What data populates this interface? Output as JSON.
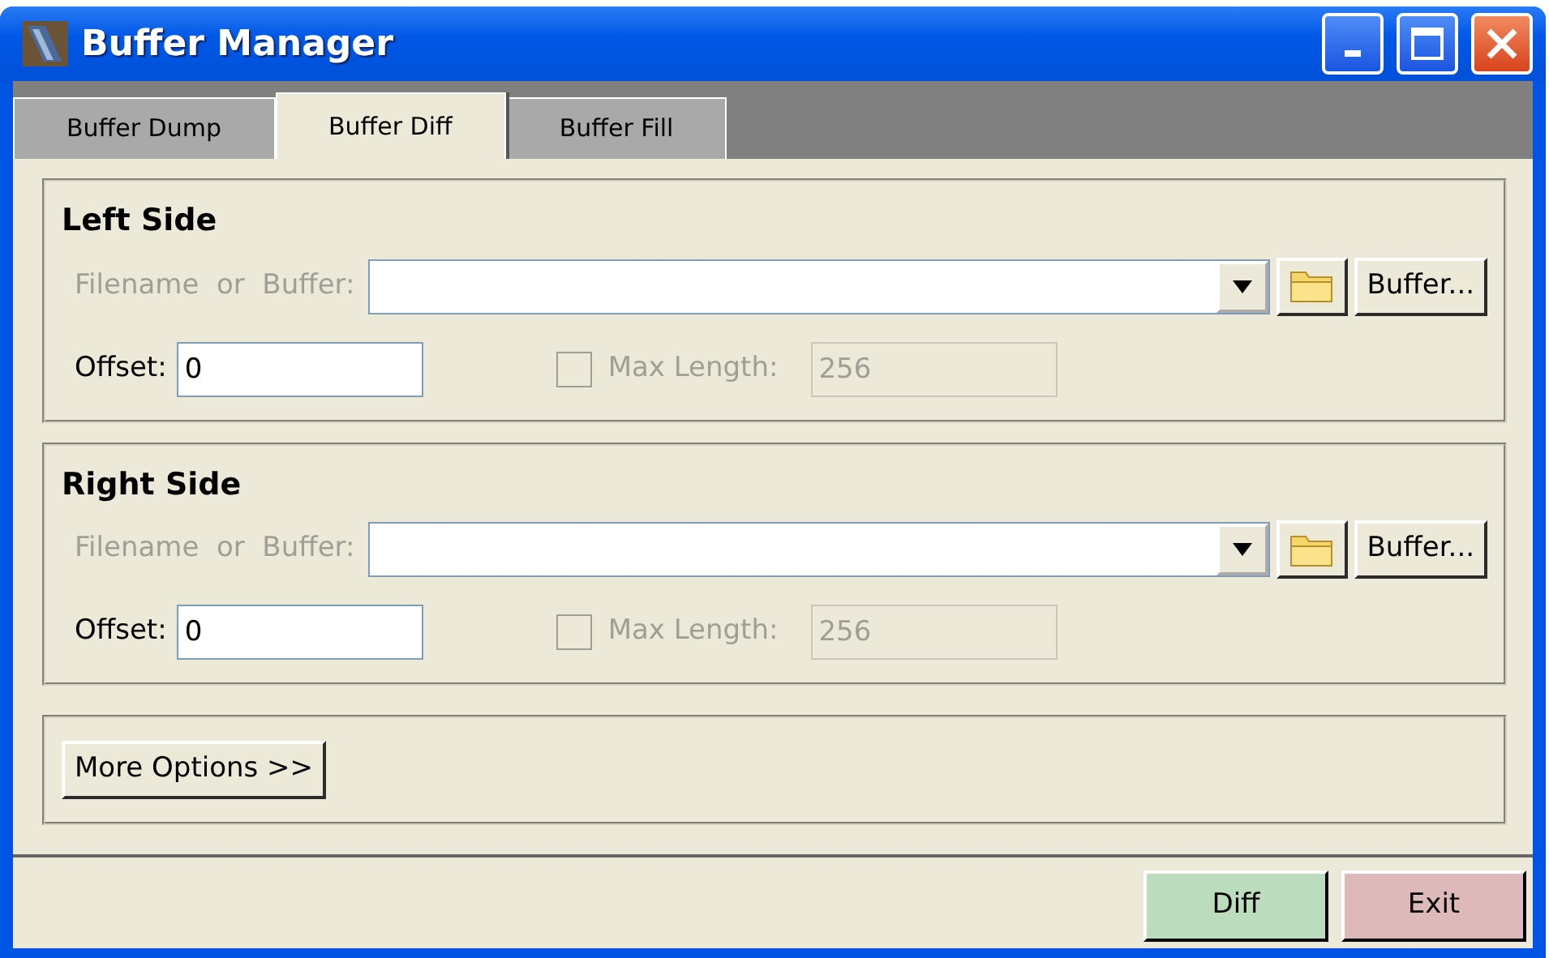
{
  "window": {
    "title": "Buffer Manager"
  },
  "tabs": [
    {
      "label": "Buffer Dump",
      "selected": false
    },
    {
      "label": "Buffer Diff",
      "selected": true
    },
    {
      "label": "Buffer Fill",
      "selected": false
    }
  ],
  "sections": [
    {
      "title": "Left Side",
      "source_label": "Filename  or  Buffer:",
      "source_label_disabled": true,
      "browse_button": "Buffer...",
      "offset_label": "Offset:",
      "offset_value": "0",
      "max_length": {
        "label": "Max Length:",
        "checked": false,
        "value": "256",
        "disabled": true
      }
    },
    {
      "title": "Right Side",
      "source_label": "Filename  or  Buffer:",
      "source_label_disabled": true,
      "browse_button": "Buffer...",
      "offset_label": "Offset:",
      "offset_value": "0",
      "max_length": {
        "label": "Max Length:",
        "checked": false,
        "value": "256",
        "disabled": true
      }
    }
  ],
  "more_options_button": "More Options >>",
  "actions": [
    {
      "label": "Diff",
      "color": "#bcdcbe"
    },
    {
      "label": "Exit",
      "color": "#ddb9b9"
    }
  ]
}
